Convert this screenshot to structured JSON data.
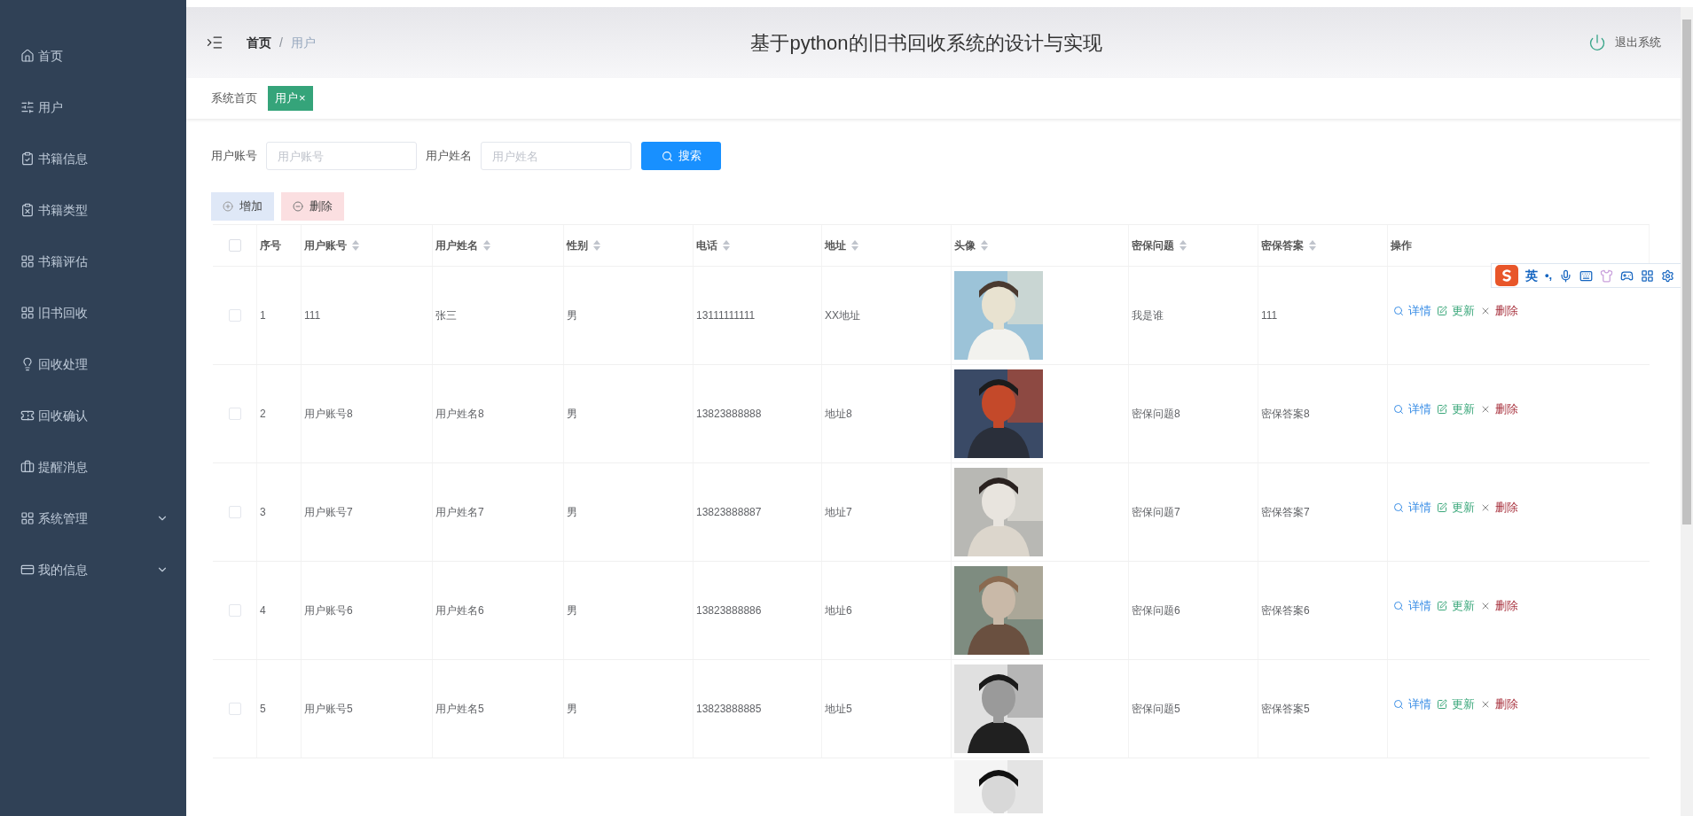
{
  "sidebar": {
    "items": [
      {
        "label": "首页",
        "expandable": false
      },
      {
        "label": "用户",
        "expandable": false
      },
      {
        "label": "书籍信息",
        "expandable": false
      },
      {
        "label": "书籍类型",
        "expandable": false
      },
      {
        "label": "书籍评估",
        "expandable": false
      },
      {
        "label": "旧书回收",
        "expandable": false
      },
      {
        "label": "回收处理",
        "expandable": false
      },
      {
        "label": "回收确认",
        "expandable": false
      },
      {
        "label": "提醒消息",
        "expandable": false
      },
      {
        "label": "系统管理",
        "expandable": true
      },
      {
        "label": "我的信息",
        "expandable": true
      }
    ]
  },
  "header": {
    "breadcrumb": [
      "首页",
      "用户"
    ],
    "breadcrumb_separator": "/",
    "title": "基于python的旧书回收系统的设计与实现",
    "logout": "退出系统"
  },
  "tabs": [
    {
      "label": "系统首页",
      "selected": false,
      "closable": false
    },
    {
      "label": "用户",
      "selected": true,
      "closable": true,
      "close_glyph": "×"
    }
  ],
  "search": {
    "fields": [
      {
        "label": "用户账号",
        "placeholder": "用户账号"
      },
      {
        "label": "用户姓名",
        "placeholder": "用户姓名"
      }
    ],
    "button": "搜索"
  },
  "actions": {
    "add": "增加",
    "delete": "删除"
  },
  "table": {
    "columns": [
      {
        "label": "序号",
        "sortable": false
      },
      {
        "label": "用户账号",
        "sortable": true
      },
      {
        "label": "用户姓名",
        "sortable": true
      },
      {
        "label": "性别",
        "sortable": true
      },
      {
        "label": "电话",
        "sortable": true
      },
      {
        "label": "地址",
        "sortable": true
      },
      {
        "label": "头像",
        "sortable": true
      },
      {
        "label": "密保问题",
        "sortable": true
      },
      {
        "label": "密保答案",
        "sortable": true
      },
      {
        "label": "操作",
        "sortable": false
      }
    ],
    "all_checked": false,
    "rows": [
      {
        "kind": "full",
        "checked": false,
        "cells": [
          "1",
          "111",
          "张三",
          "男",
          "13111111111",
          "XX地址",
          "我是谁",
          "111"
        ],
        "actions": {
          "detail": "详情",
          "update": "更新",
          "delete": "删除"
        }
      },
      {
        "kind": "full",
        "checked": false,
        "cells": [
          "2",
          "用户账号8",
          "用户姓名8",
          "男",
          "13823888888",
          "地址8",
          "密保问题8",
          "密保答案8"
        ],
        "actions": {
          "detail": "详情",
          "update": "更新",
          "delete": "删除"
        }
      },
      {
        "kind": "full",
        "checked": false,
        "cells": [
          "3",
          "用户账号7",
          "用户姓名7",
          "男",
          "13823888887",
          "地址7",
          "密保问题7",
          "密保答案7"
        ],
        "actions": {
          "detail": "详情",
          "update": "更新",
          "delete": "删除"
        }
      },
      {
        "kind": "full",
        "checked": false,
        "cells": [
          "4",
          "用户账号6",
          "用户姓名6",
          "男",
          "13823888886",
          "地址6",
          "密保问题6",
          "密保答案6"
        ],
        "actions": {
          "detail": "详情",
          "update": "更新",
          "delete": "删除"
        }
      },
      {
        "kind": "full",
        "checked": false,
        "cells": [
          "5",
          "用户账号5",
          "用户姓名5",
          "男",
          "13823888885",
          "地址5",
          "密保问题5",
          "密保答案5"
        ],
        "actions": {
          "detail": "详情",
          "update": "更新",
          "delete": "删除"
        }
      },
      {
        "kind": "partial"
      }
    ]
  },
  "ime_toolbar": {
    "mode": "英",
    "punctuation": "•,"
  }
}
